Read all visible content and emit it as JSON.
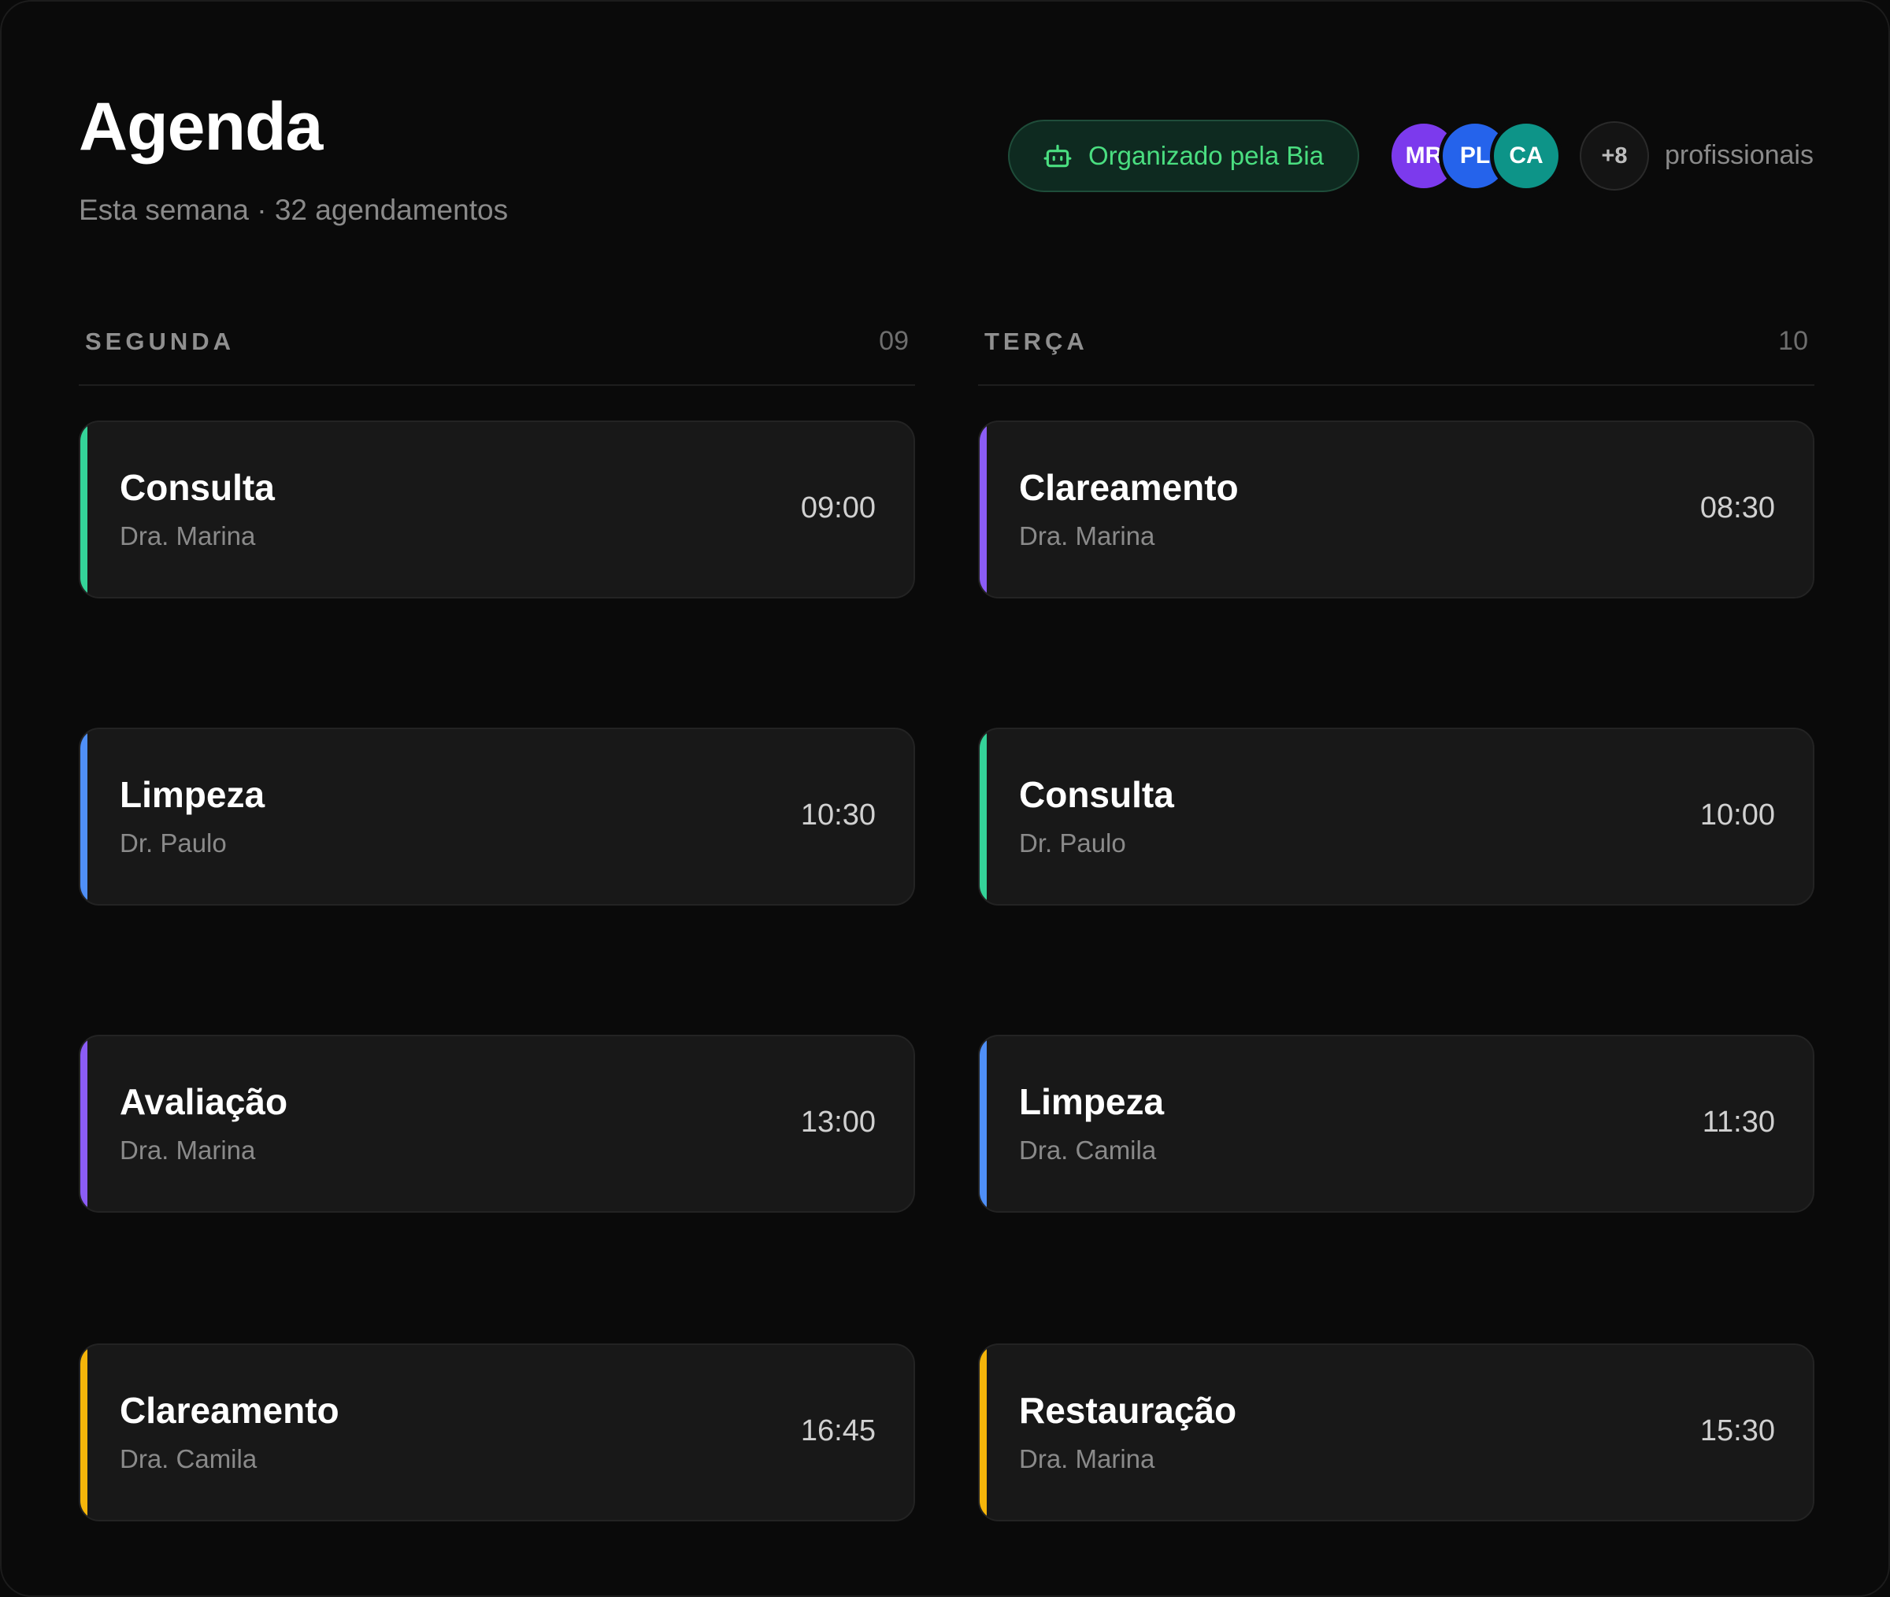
{
  "header": {
    "title": "Agenda",
    "subtitle": "Esta semana · 32 agendamentos"
  },
  "badge": {
    "icon": "robot-icon",
    "label": "Organizado pela Bia",
    "color": "#4ade80"
  },
  "team": {
    "avatars": [
      {
        "initials": "MR",
        "color": "#7c3aed"
      },
      {
        "initials": "PL",
        "color": "#2563eb"
      },
      {
        "initials": "CA",
        "color": "#0d9488"
      }
    ],
    "more": "+8",
    "label": "profissionais"
  },
  "colors": {
    "green": "#34d399",
    "blue": "#4f8ff7",
    "purple": "#8b5cf6",
    "yellow": "#f5b50a"
  },
  "days": [
    {
      "name": "SEGUNDA",
      "number": "09",
      "appointments": [
        {
          "service": "Consulta",
          "professional": "Dra. Marina",
          "time": "09:00",
          "color": "green"
        },
        {
          "service": "Limpeza",
          "professional": "Dr. Paulo",
          "time": "10:30",
          "color": "blue"
        },
        {
          "service": "Avaliação",
          "professional": "Dra. Marina",
          "time": "13:00",
          "color": "purple"
        },
        {
          "service": "Clareamento",
          "professional": "Dra. Camila",
          "time": "16:45",
          "color": "yellow"
        }
      ]
    },
    {
      "name": "TERÇA",
      "number": "10",
      "appointments": [
        {
          "service": "Clareamento",
          "professional": "Dra. Marina",
          "time": "08:30",
          "color": "purple"
        },
        {
          "service": "Consulta",
          "professional": "Dr. Paulo",
          "time": "10:00",
          "color": "green"
        },
        {
          "service": "Limpeza",
          "professional": "Dra. Camila",
          "time": "11:30",
          "color": "blue"
        },
        {
          "service": "Restauração",
          "professional": "Dra. Marina",
          "time": "15:30",
          "color": "yellow"
        }
      ]
    }
  ]
}
